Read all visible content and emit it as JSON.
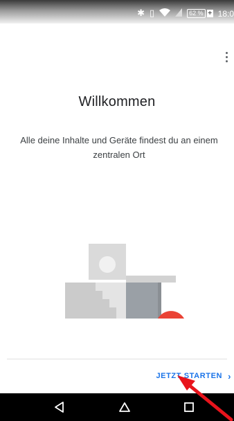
{
  "status_bar": {
    "icons": [
      "bluetooth-icon",
      "vibrate-icon",
      "wifi-icon",
      "signal-icon"
    ],
    "battery_percent": "62 %",
    "battery_plus": "+",
    "time": "18:0"
  },
  "menu": {
    "icon": "more-vert-icon"
  },
  "welcome": {
    "title": "Willkommen",
    "subtitle": "Alle deine Inhalte und Geräte findest du an einem zentralen Ort"
  },
  "footer": {
    "start_label": "JETZT STARTEN",
    "start_chevron": "›"
  },
  "nav": {
    "back_icon": "back-triangle-icon",
    "home_icon": "home-icon",
    "recents_icon": "recents-square-icon"
  },
  "colors": {
    "accent": "#1a73e8",
    "annotation_arrow": "#e8141c",
    "illustration_red": "#ea4335",
    "illustration_gray_light": "#cfcfcf",
    "illustration_gray_dark": "#9aa0a6"
  }
}
